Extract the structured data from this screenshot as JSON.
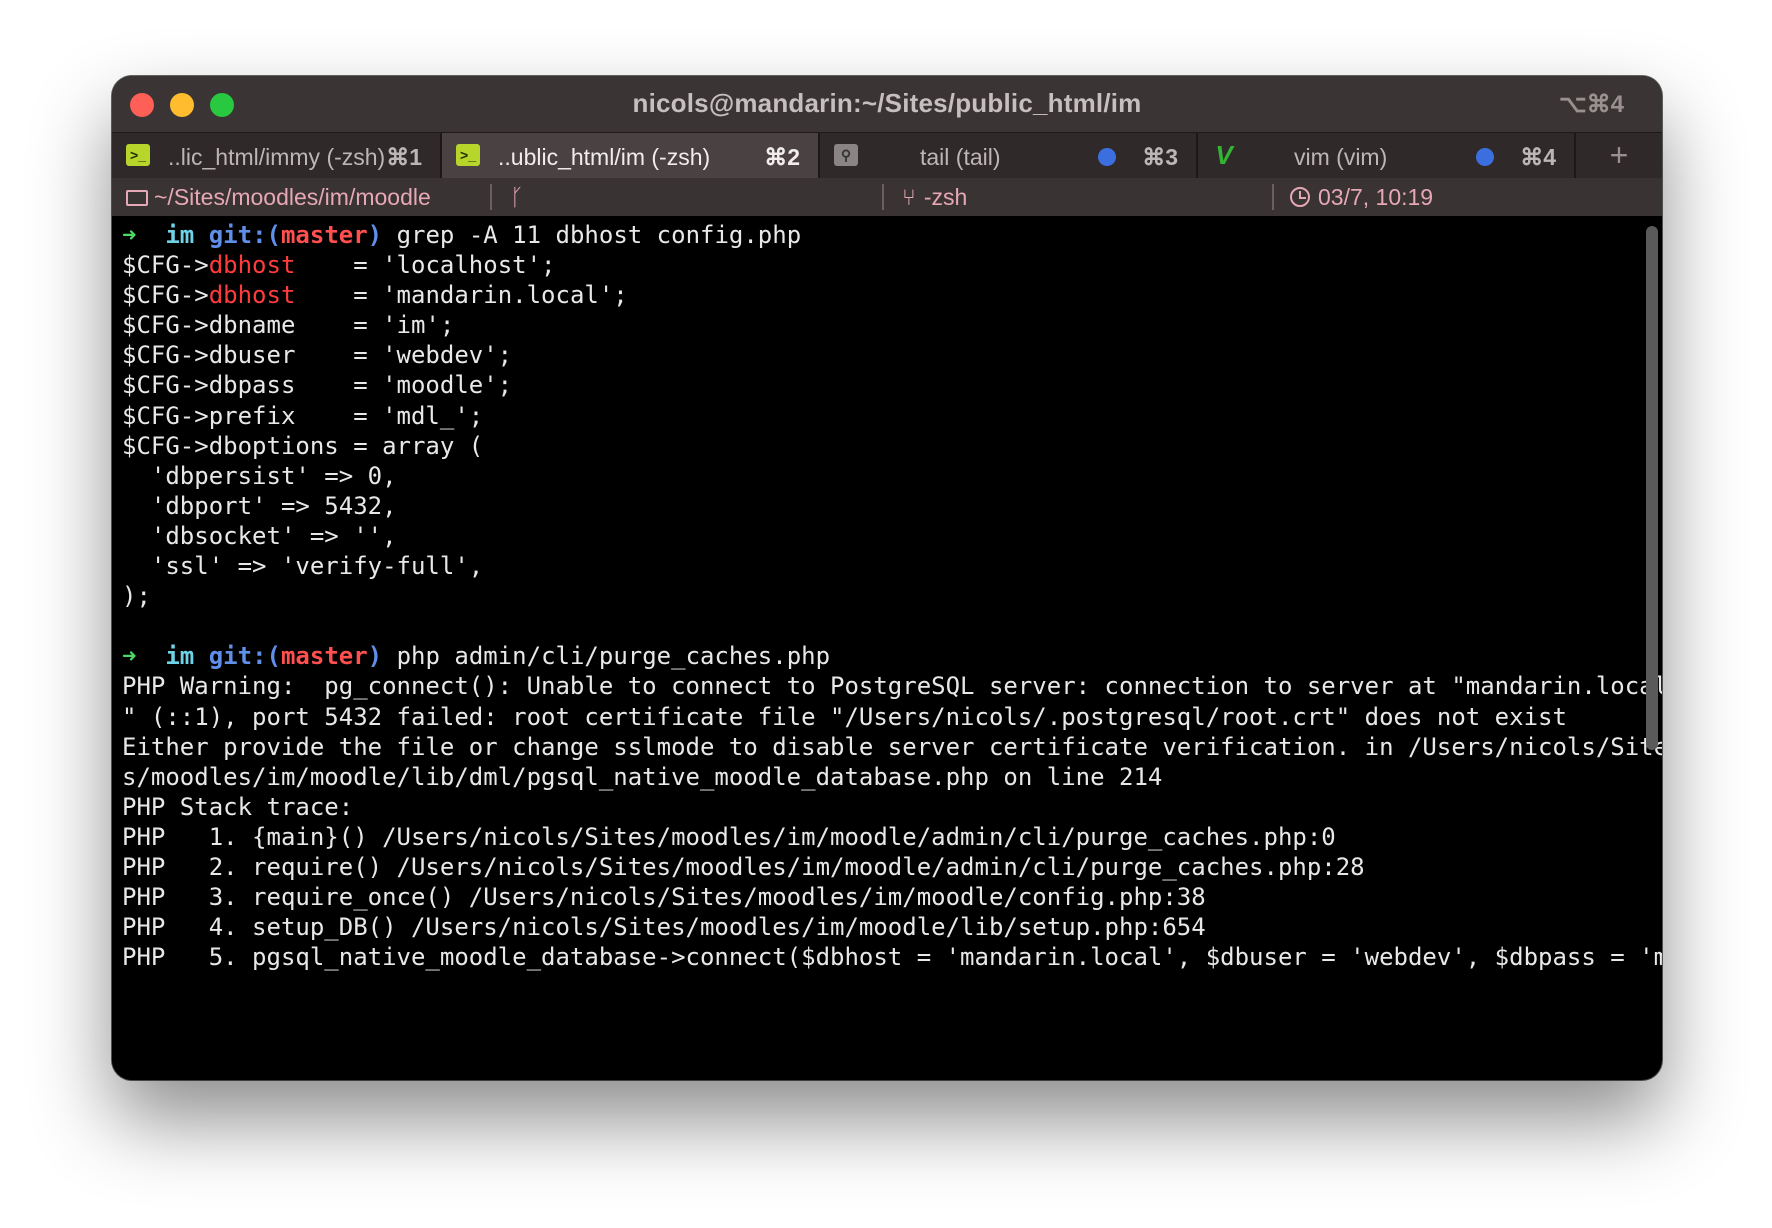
{
  "window": {
    "title": "nicols@mandarin:~/Sites/public_html/im",
    "shortcut": "⌥⌘4"
  },
  "tabs": [
    {
      "label": "..lic_html/immy (-zsh)",
      "key": "⌘1",
      "icon": "terminal-icon",
      "active": false
    },
    {
      "label": "..ublic_html/im (-zsh)",
      "key": "⌘2",
      "icon": "terminal-icon",
      "active": true
    },
    {
      "label": "tail (tail)",
      "key": "⌘3",
      "icon": "search-icon",
      "active": false,
      "activity": true
    },
    {
      "label": "vim (vim)",
      "key": "⌘4",
      "icon": "vim-icon",
      "active": false,
      "activity": true
    }
  ],
  "new_tab": "+",
  "status": {
    "path": "~/Sites/moodles/im/moodle",
    "git_glyph": "ᚴ",
    "job": "-zsh",
    "time": "03/7, 10:19"
  },
  "terminal": {
    "prompt1": {
      "arrow": "➜",
      "dir": "im",
      "git": "git:(",
      "branch": "master",
      "git_close": ")",
      "command": "grep -A 11 dbhost config.php"
    },
    "grep_lines": [
      {
        "pre": "$CFG->",
        "hl": "dbhost",
        "post": "    = 'localhost';"
      },
      {
        "pre": "$CFG->",
        "hl": "dbhost",
        "post": "    = 'mandarin.local';"
      },
      {
        "text": "$CFG->dbname    = 'im';"
      },
      {
        "text": "$CFG->dbuser    = 'webdev';"
      },
      {
        "text": "$CFG->dbpass    = 'moodle';"
      },
      {
        "text": "$CFG->prefix    = 'mdl_';"
      },
      {
        "text": "$CFG->dboptions = array ("
      },
      {
        "text": "  'dbpersist' => 0,"
      },
      {
        "text": "  'dbport' => 5432,"
      },
      {
        "text": "  'dbsocket' => '',"
      },
      {
        "text": "  'ssl' => 'verify-full',"
      },
      {
        "text": ");"
      }
    ],
    "prompt2": {
      "arrow": "➜",
      "dir": "im",
      "git": "git:(",
      "branch": "master",
      "git_close": ")",
      "command": "php admin/cli/purge_caches.php"
    },
    "output_lines": [
      "PHP Warning:  pg_connect(): Unable to connect to PostgreSQL server: connection to server at \"mandarin.local",
      "\" (::1), port 5432 failed: root certificate file \"/Users/nicols/.postgresql/root.crt\" does not exist",
      "Either provide the file or change sslmode to disable server certificate verification. in /Users/nicols/Site",
      "s/moodles/im/moodle/lib/dml/pgsql_native_moodle_database.php on line 214",
      "PHP Stack trace:",
      "PHP   1. {main}() /Users/nicols/Sites/moodles/im/moodle/admin/cli/purge_caches.php:0",
      "PHP   2. require() /Users/nicols/Sites/moodles/im/moodle/admin/cli/purge_caches.php:28",
      "PHP   3. require_once() /Users/nicols/Sites/moodles/im/moodle/config.php:38",
      "PHP   4. setup_DB() /Users/nicols/Sites/moodles/im/moodle/lib/setup.php:654",
      "PHP   5. pgsql_native_moodle_database->connect($dbhost = 'mandarin.local', $dbuser = 'webdev', $dbpass = 'm"
    ]
  },
  "colors": {
    "accent_status": "#e6a7b7",
    "prompt_arrow": "#4cd964",
    "branch": "#ff4f4f",
    "git": "#5f8fe8"
  }
}
